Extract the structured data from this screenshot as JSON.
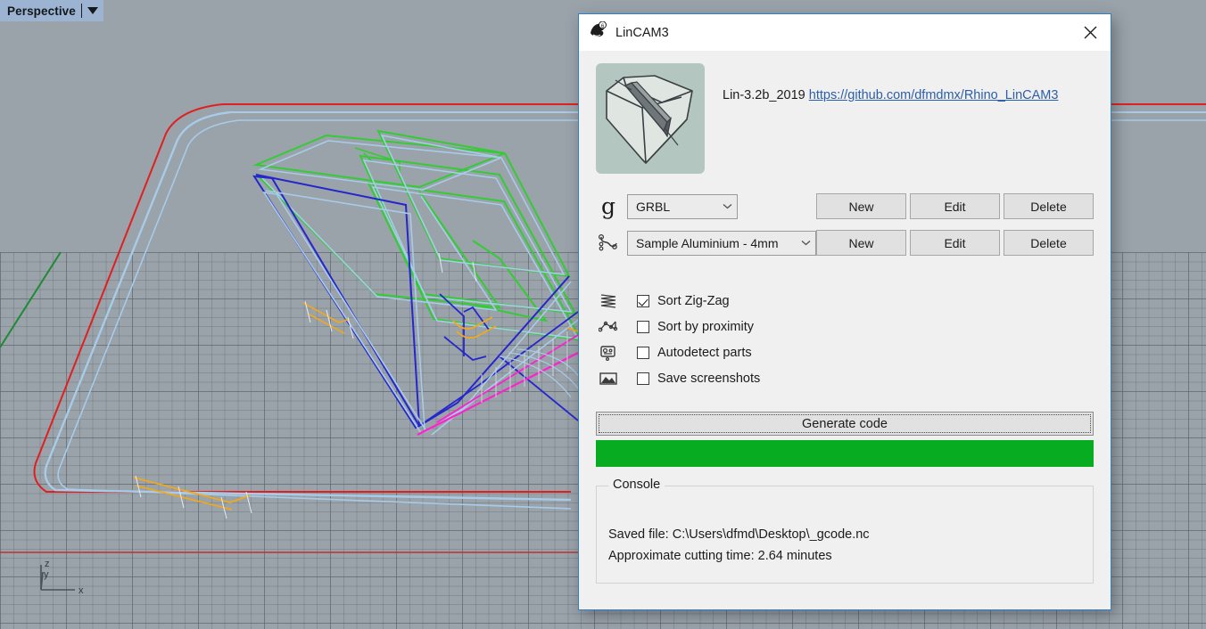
{
  "viewport": {
    "tab_label": "Perspective",
    "caret_icon": "chevron-down-icon",
    "axis": {
      "x_label": "x",
      "y_label": "y",
      "z_label": "z"
    },
    "colors": {
      "background": "#9aa2aa",
      "grid_major": "#5a626a",
      "grid_minor": "#6e767e",
      "x_axis": "#c03030",
      "y_axis": "#1f8a34",
      "toolpath_green": "#33cc33",
      "toolpath_blue": "#2626cc",
      "toolpath_lightblue": "#a8cbe8",
      "toolpath_orange": "#f0a81e",
      "toolpath_magenta": "#ff22cc",
      "toolpath_red": "#e02020"
    }
  },
  "dialog": {
    "title": "LinCAM3",
    "app_icon": "rhino-icon",
    "close_icon": "close-icon",
    "thumbnail_icon": "lincam-preview-thumbnail",
    "version": "Lin-3.2b_2019",
    "link_text": "https://github.com/dfmdmx/Rhino_LinCAM3",
    "postprocessor": {
      "icon": "gcode-g-icon",
      "value": "GRBL",
      "chevron_icon": "chevron-down-icon",
      "new_label": "New",
      "edit_label": "Edit",
      "delete_label": "Delete"
    },
    "material": {
      "icon": "toolpath-curve-icon",
      "value": "Sample Aluminium - 4mm",
      "chevron_icon": "chevron-down-icon",
      "new_label": "New",
      "edit_label": "Edit",
      "delete_label": "Delete"
    },
    "options": [
      {
        "icon": "zigzag-icon",
        "label": "Sort Zig-Zag",
        "checked": true
      },
      {
        "icon": "proximity-icon",
        "label": "Sort by proximity",
        "checked": false
      },
      {
        "icon": "autodetect-icon",
        "label": "Autodetect parts",
        "checked": false
      },
      {
        "icon": "image-icon",
        "label": "Save screenshots",
        "checked": false
      }
    ],
    "generate_label": "Generate code",
    "progress": {
      "percent": 100,
      "color": "#07ac21"
    },
    "console": {
      "legend": "Console",
      "lines": [
        "Saved file: C:\\Users\\dfmd\\Desktop\\_gcode.nc",
        "Approximate cutting time: 2.64 minutes"
      ]
    }
  }
}
